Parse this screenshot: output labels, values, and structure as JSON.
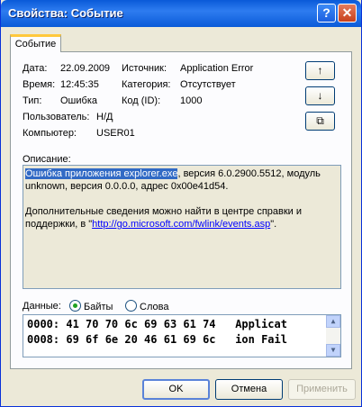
{
  "window": {
    "title": "Свойства: Событие",
    "help_glyph": "?",
    "close_glyph": "✕"
  },
  "tab": {
    "label": "Событие"
  },
  "fields": {
    "date_label": "Дата:",
    "date_value": "22.09.2009",
    "time_label": "Время:",
    "time_value": "12:45:35",
    "type_label": "Тип:",
    "type_value": "Ошибка",
    "user_label": "Пользователь:",
    "user_value": "Н/Д",
    "computer_label": "Компьютер:",
    "computer_value": "USER01",
    "source_label": "Источник:",
    "source_value": "Application Error",
    "category_label": "Категория:",
    "category_value": "Отсутствует",
    "eventid_label": "Код (ID):",
    "eventid_value": "1000"
  },
  "side_buttons": {
    "up": "↑",
    "down": "↓",
    "copy": "⧉"
  },
  "description": {
    "label": "Описание:",
    "highlight": "Ошибка приложения explorer.exe",
    "rest_line1": ", версия 6.0.2900.5512, модуль unknown, версия 0.0.0.0, адрес 0x00e41d54.",
    "para2": "Дополнительные сведения можно найти в центре справки и поддержки, в \"",
    "link": "http://go.microsoft.com/fwlink/events.asp",
    "para2_end": "\"."
  },
  "data_section": {
    "label": "Данные:",
    "bytes_label": "Байты",
    "words_label": "Слова",
    "selected": "Байты",
    "lines": [
      "0000: 41 70 70 6c 69 63 61 74   Applicat",
      "0008: 69 6f 6e 20 46 61 69 6c   ion Fail"
    ]
  },
  "buttons": {
    "ok": "OK",
    "cancel": "Отмена",
    "apply": "Применить"
  }
}
